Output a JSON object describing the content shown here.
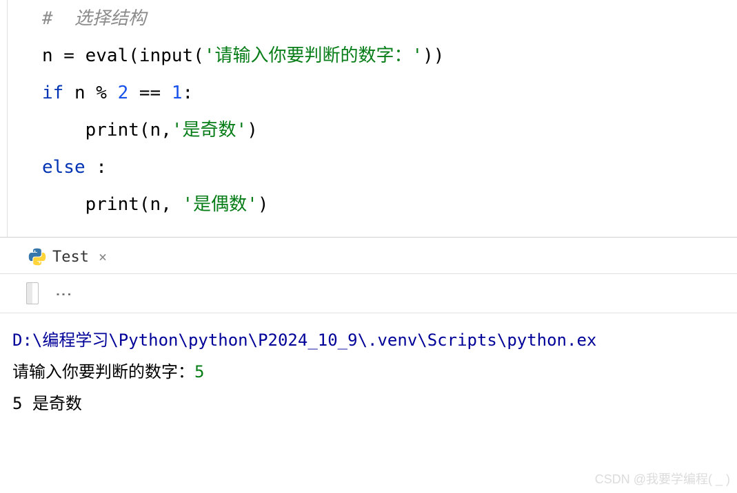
{
  "code": {
    "line1_comment_prefix": "#  ",
    "line1_comment_text": "选择结构",
    "line2_prefix": "n = ",
    "line2_eval": "eval",
    "line2_paren1": "(",
    "line2_input": "input",
    "line2_paren2": "(",
    "line2_string": "'请输入你要判断的数字：'",
    "line2_close": "))",
    "line3_if": "if",
    "line3_expr1": " n % ",
    "line3_num2": "2",
    "line3_expr2": " == ",
    "line3_num1": "1",
    "line3_colon": ":",
    "line4_indent": "    ",
    "line4_print": "print",
    "line4_paren": "(n,",
    "line4_string": "'是奇数'",
    "line4_close": ")",
    "line5_else": "else",
    "line5_colon": " :",
    "line6_indent": "    ",
    "line6_print": "print",
    "line6_paren": "(n, ",
    "line6_string": "'是偶数'",
    "line6_close": ")"
  },
  "tab": {
    "label": "Test",
    "close": "×"
  },
  "toolbar": {
    "more": "⋮"
  },
  "output": {
    "path": "D:\\编程学习\\Python\\python\\P2024_10_9\\.venv\\Scripts\\python.ex",
    "prompt": "请输入你要判断的数字：",
    "input_value": "5",
    "result": "5 是奇数"
  },
  "watermark": "CSDN @我要学编程( _ )"
}
